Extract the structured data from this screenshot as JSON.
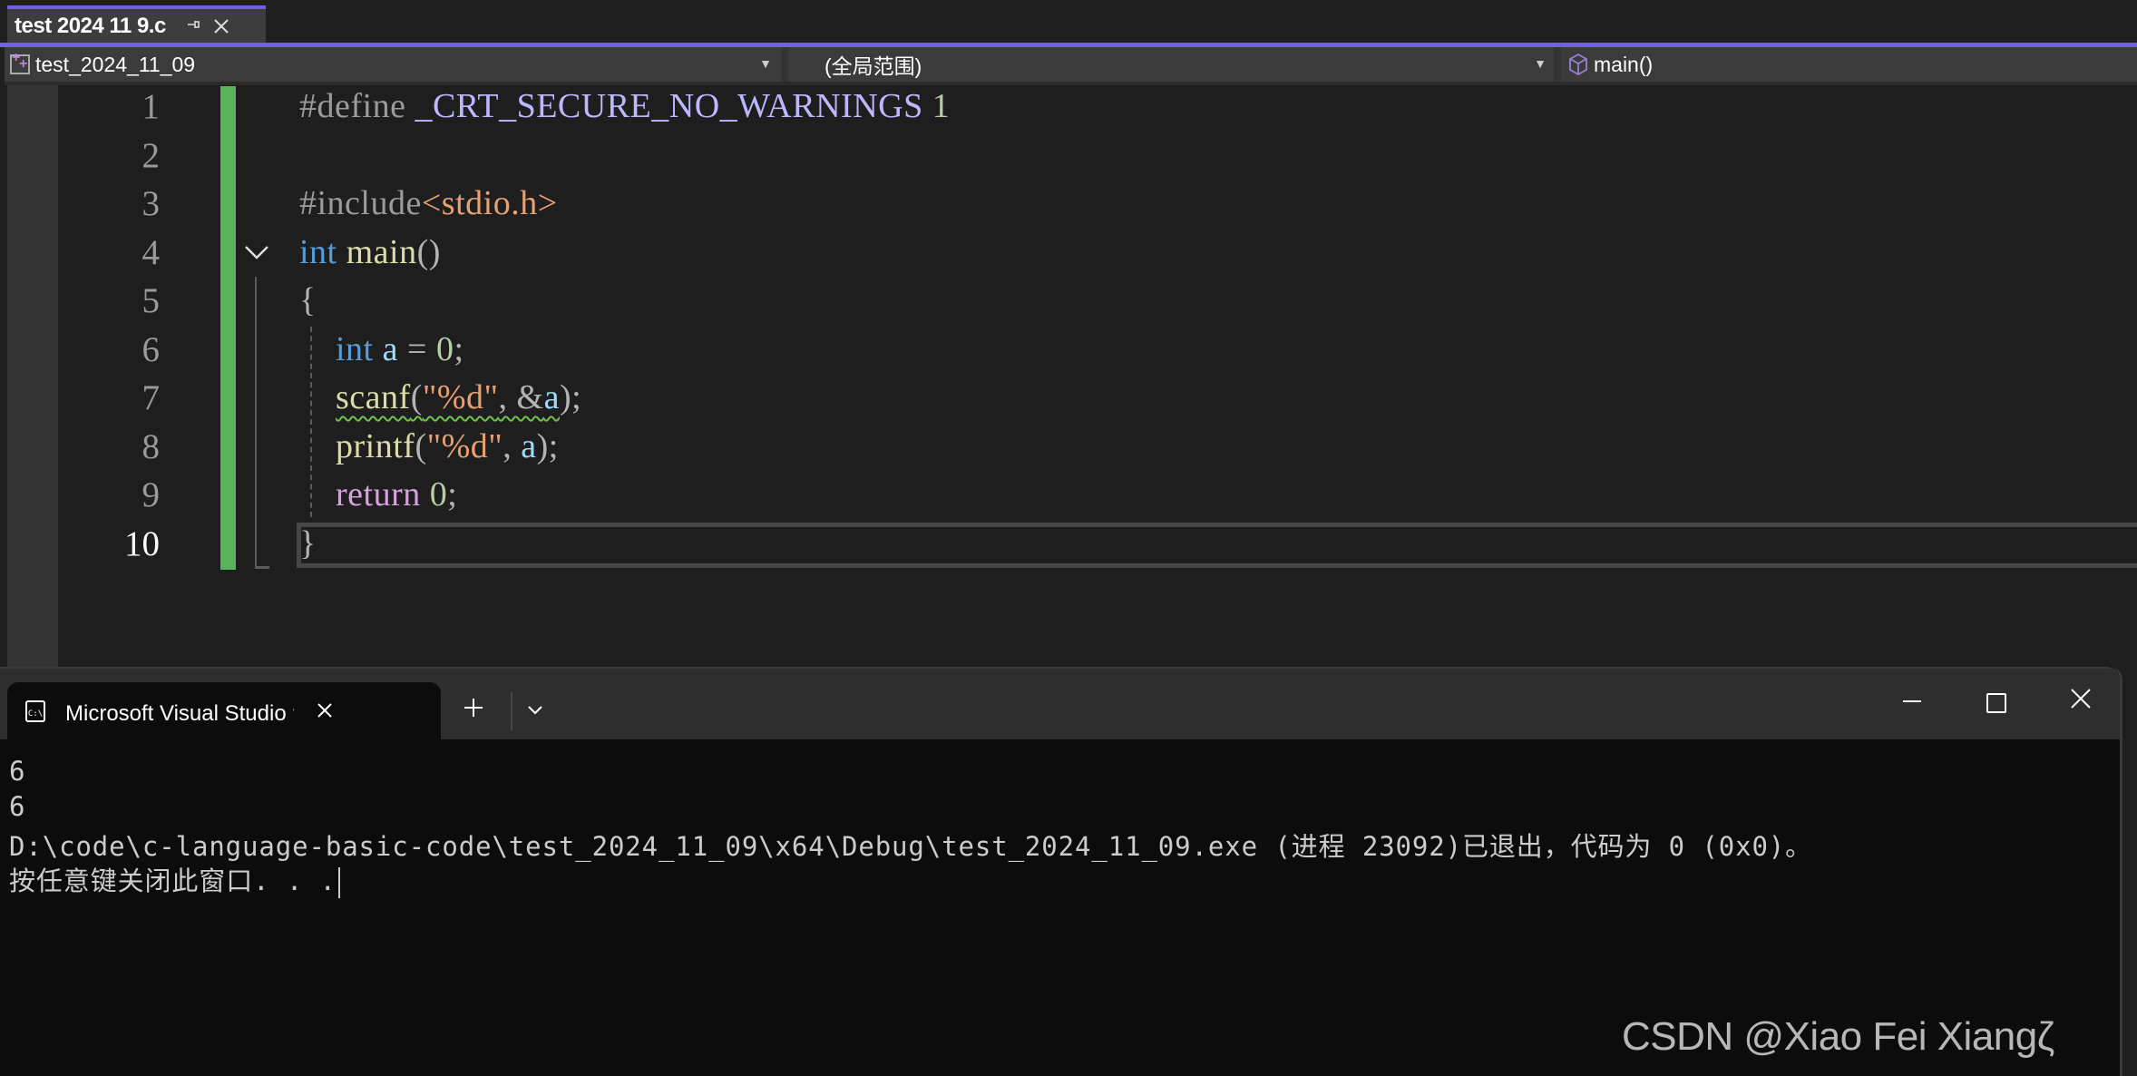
{
  "doc_tab": {
    "title": "test 2024 11 9.c",
    "pin_icon": "⊣",
    "close_icon": "✕"
  },
  "nav_bar": {
    "project": "test_2024_11_09",
    "scope": "(全局范围)",
    "member": "main()"
  },
  "editor": {
    "line_numbers": [
      "1",
      "2",
      "3",
      "4",
      "5",
      "6",
      "7",
      "8",
      "9",
      "10"
    ],
    "active_line": "10",
    "lines": [
      [
        {
          "t": "pp",
          "v": "#define "
        },
        {
          "t": "macro",
          "v": "_CRT_SECURE_NO_WARNINGS"
        },
        {
          "t": "num",
          "v": " 1"
        }
      ],
      [],
      [
        {
          "t": "pp",
          "v": "#include"
        },
        {
          "t": "str",
          "v": "<stdio.h>"
        }
      ],
      [
        {
          "t": "kw",
          "v": "int"
        },
        {
          "t": "punc",
          "v": " "
        },
        {
          "t": "fn",
          "v": "main"
        },
        {
          "t": "punc",
          "v": "()"
        }
      ],
      [
        {
          "t": "punc",
          "v": "{"
        }
      ],
      [
        {
          "t": "punc",
          "v": "    "
        },
        {
          "t": "kw",
          "v": "int"
        },
        {
          "t": "punc",
          "v": " "
        },
        {
          "t": "var",
          "v": "a"
        },
        {
          "t": "punc",
          "v": " = "
        },
        {
          "t": "num",
          "v": "0"
        },
        {
          "t": "punc",
          "v": ";"
        }
      ],
      [
        {
          "t": "punc",
          "v": "    "
        },
        {
          "t": "fn squiggle",
          "v": "scanf"
        },
        {
          "t": "punc squiggle",
          "v": "("
        },
        {
          "t": "str squiggle",
          "v": "\"%d\""
        },
        {
          "t": "punc squiggle",
          "v": ", &"
        },
        {
          "t": "var squiggle",
          "v": "a"
        },
        {
          "t": "punc",
          "v": ");"
        }
      ],
      [
        {
          "t": "punc",
          "v": "    "
        },
        {
          "t": "fn",
          "v": "printf"
        },
        {
          "t": "punc",
          "v": "("
        },
        {
          "t": "str",
          "v": "\"%d\""
        },
        {
          "t": "punc",
          "v": ", "
        },
        {
          "t": "var",
          "v": "a"
        },
        {
          "t": "punc",
          "v": ");"
        }
      ],
      [
        {
          "t": "punc",
          "v": "    "
        },
        {
          "t": "ctl",
          "v": "return"
        },
        {
          "t": "punc",
          "v": " "
        },
        {
          "t": "num",
          "v": "0"
        },
        {
          "t": "punc",
          "v": ";"
        }
      ],
      [
        {
          "t": "punc",
          "v": "}"
        }
      ]
    ]
  },
  "terminal": {
    "tab_label": "Microsoft Visual Studio 调试控制台",
    "icon_text": "C:\\",
    "new_tab": "+",
    "dropdown": "⌄",
    "close_tab": "✕",
    "window_close": "✕",
    "output": [
      "6",
      "6",
      "D:\\code\\c-language-basic-code\\test_2024_11_09\\x64\\Debug\\test_2024_11_09.exe (进程 23092)已退出，代码为 0 (0x0)。",
      "按任意键关闭此窗口. . ."
    ]
  },
  "watermark": "CSDN @Xiao Fei Xiangζ",
  "colors": {
    "accent": "#7160e8",
    "change_bar": "#57b45c",
    "keyword": "#569cd6",
    "function": "#dcdcaa",
    "string": "#e8a073",
    "macro": "#beb7ff",
    "control": "#d8a0df",
    "variable": "#9cdcfe",
    "number": "#b5cea8",
    "squiggle": "#6fc34a"
  }
}
